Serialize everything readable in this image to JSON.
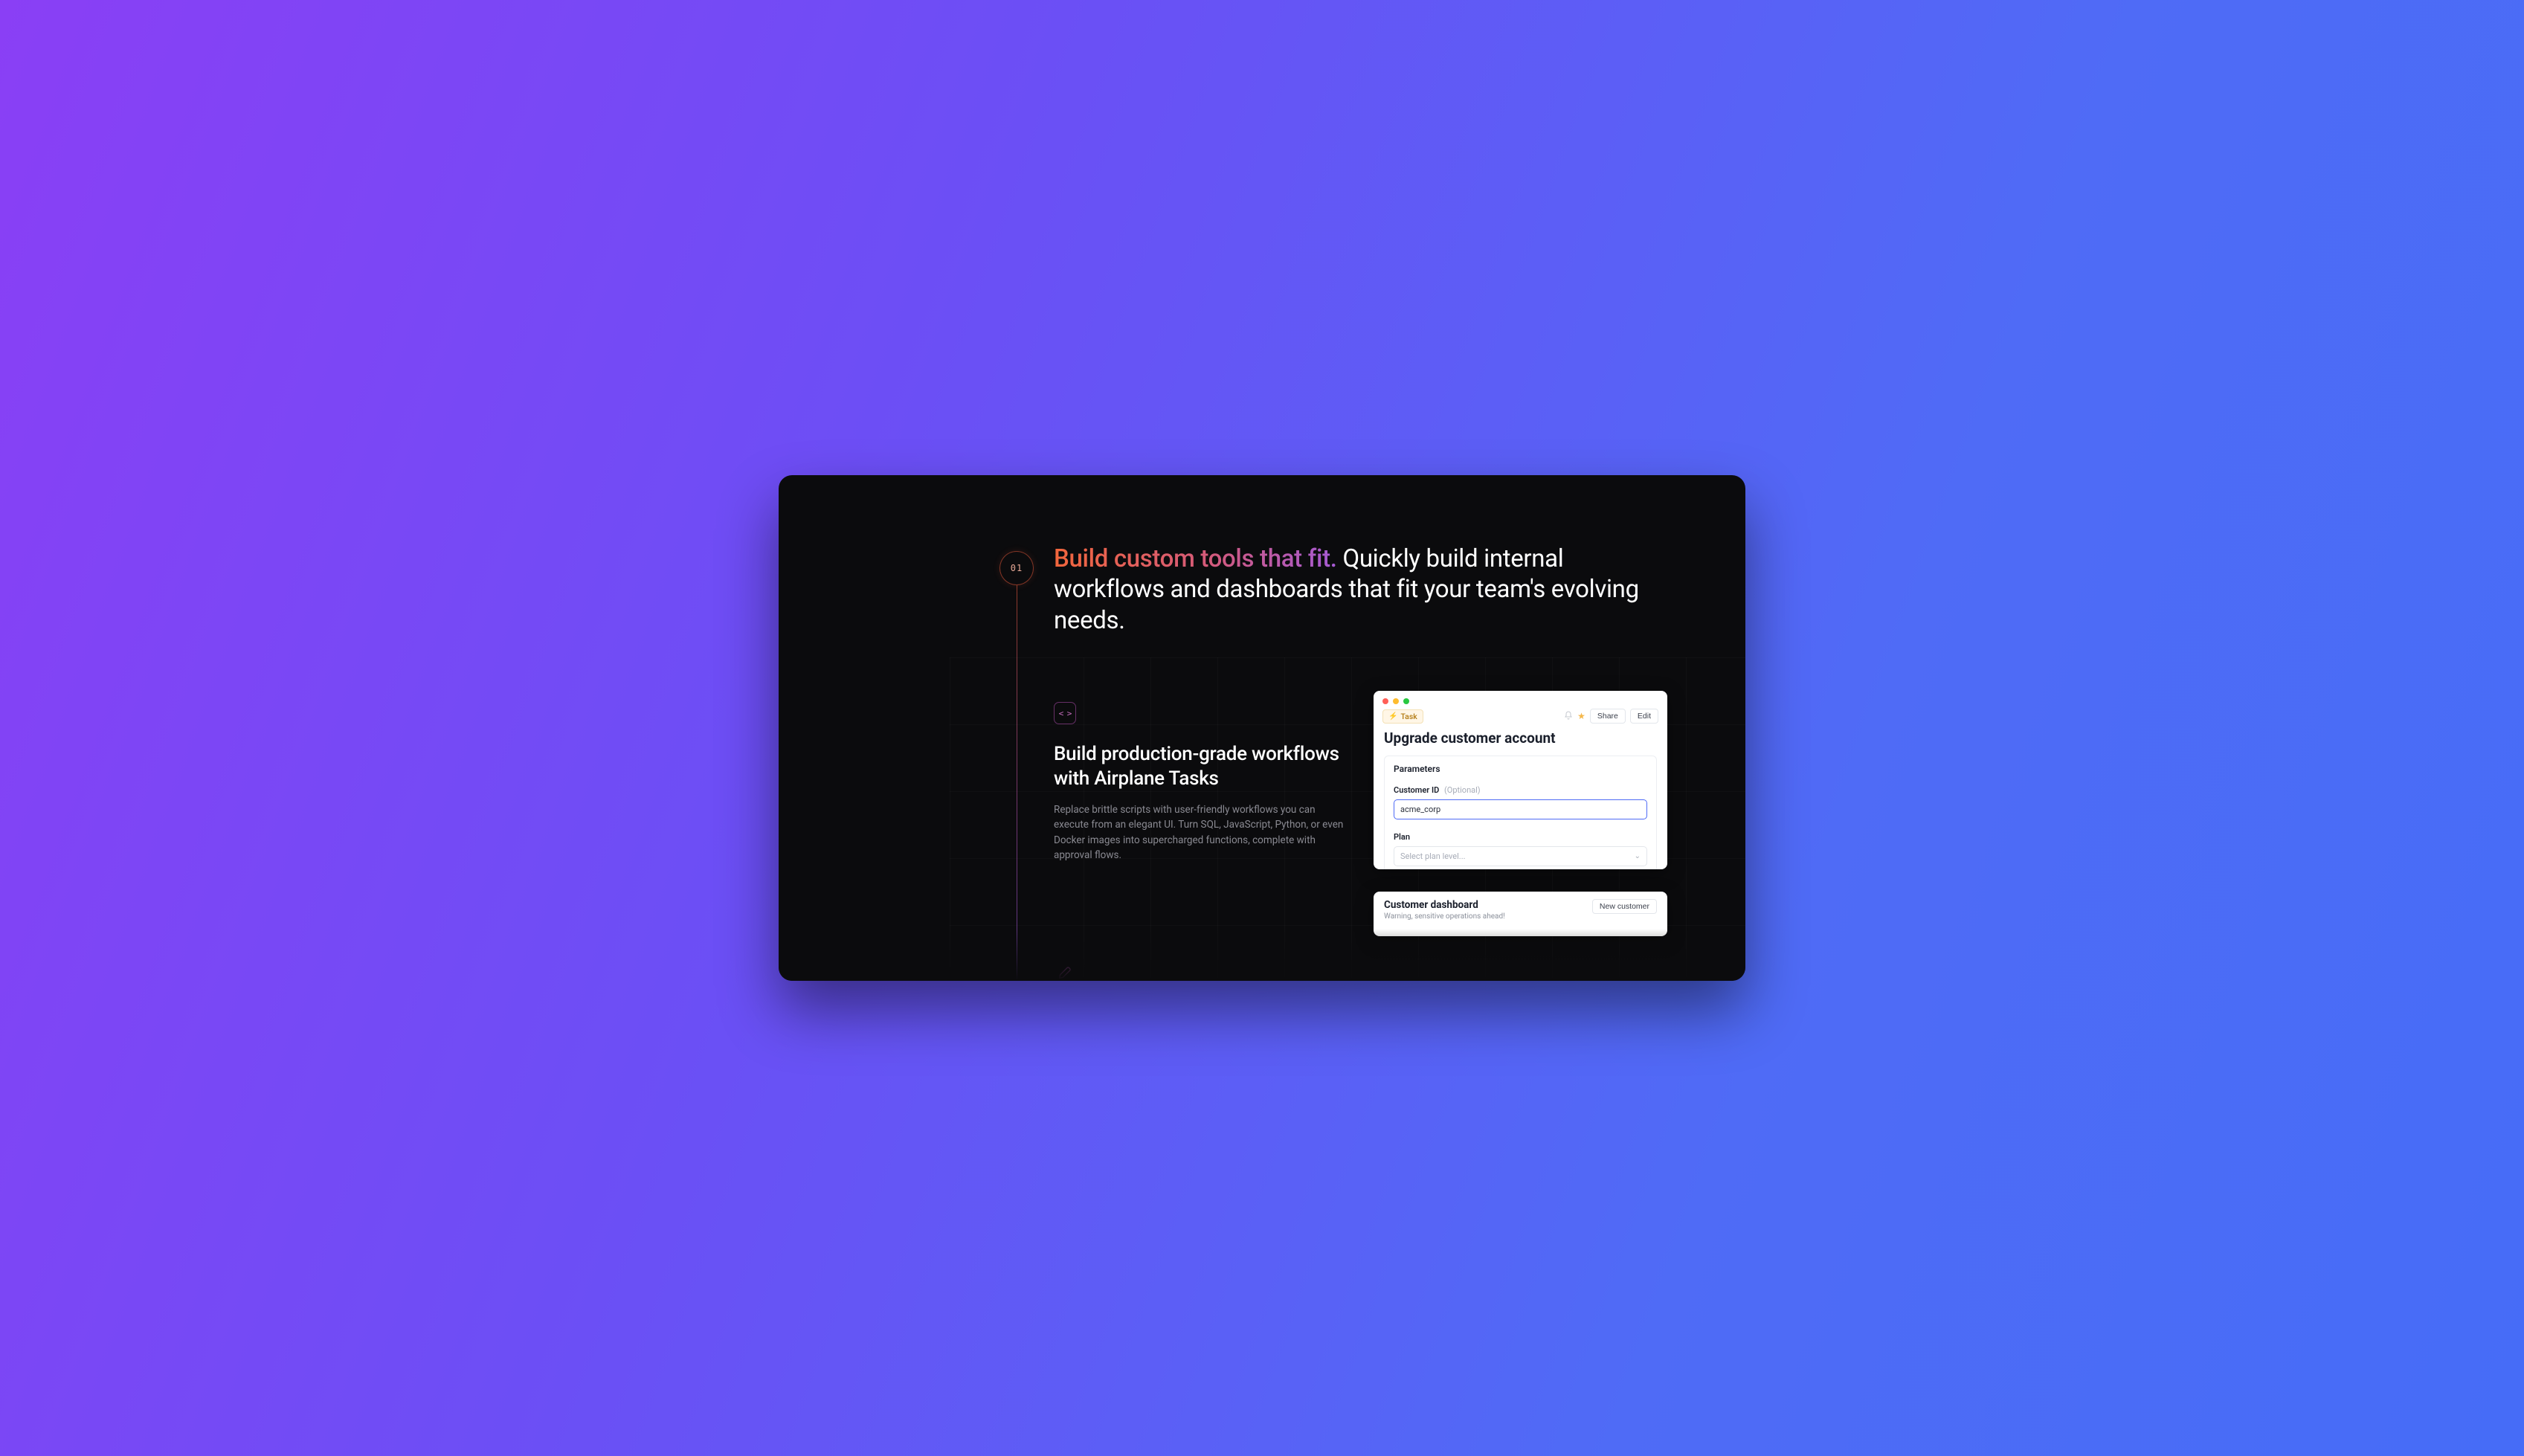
{
  "step": {
    "number": "01"
  },
  "headline": {
    "accent": "Build custom tools that fit.",
    "rest": " Quickly build internal workflows and dashboards that fit your team's evolving needs."
  },
  "feature": {
    "icon_label": "< >",
    "title": "Build production-grade workflows with Airplane Tasks",
    "body": "Replace brittle scripts with user-friendly workflows you can execute from an elegant UI. Turn SQL, JavaScript, Python, or even Docker images into supercharged functions, complete with approval flows."
  },
  "task_mock": {
    "badge": "Task",
    "share_label": "Share",
    "edit_label": "Edit",
    "title": "Upgrade customer account",
    "parameters_label": "Parameters",
    "field1": {
      "label": "Customer ID",
      "optional": "(Optional)",
      "value": "acme_corp"
    },
    "field2": {
      "label": "Plan",
      "placeholder": "Select plan level..."
    }
  },
  "dashboard_mock": {
    "title": "Customer dashboard",
    "subtitle": "Warning, sensitive operations ahead!",
    "button": "New customer"
  },
  "colors": {
    "gradient_start": "#f2663c",
    "gradient_mid": "#d45a7b",
    "gradient_end": "#a45ad4",
    "accent_blue": "#4f6bf6"
  }
}
